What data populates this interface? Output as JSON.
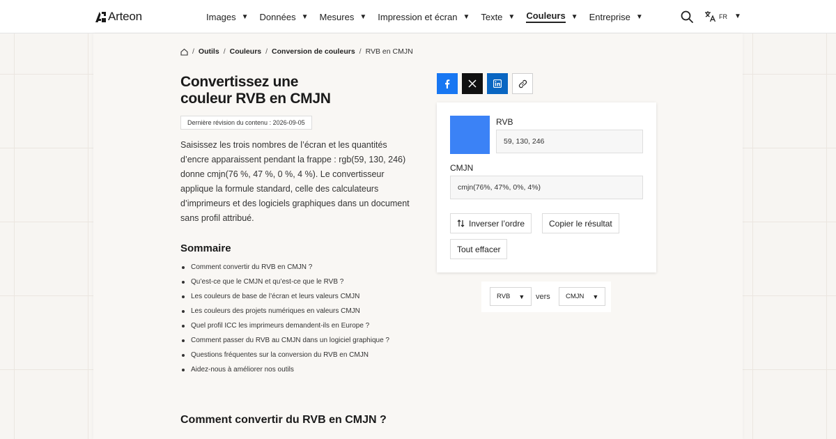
{
  "header": {
    "logo_text": "Arteon",
    "nav": [
      {
        "label": "Images"
      },
      {
        "label": "Données"
      },
      {
        "label": "Mesures"
      },
      {
        "label": "Impression et écran"
      },
      {
        "label": "Texte"
      },
      {
        "label": "Couleurs",
        "active": true
      },
      {
        "label": "Entreprise"
      }
    ],
    "lang": "FR",
    "icons": {
      "search": "search-icon",
      "translate": "translate-icon",
      "caret": "chevron-down-icon"
    }
  },
  "breadcrumb": {
    "home_icon": "home-icon",
    "items": [
      "Outils",
      "Couleurs",
      "Conversion de couleurs"
    ],
    "current": "RVB en CMJN"
  },
  "page": {
    "title_line1": "Convertissez une",
    "title_line2": "couleur RVB en CMJN",
    "revision": "Dernière révision du contenu : 2026-09-05",
    "intro": "Saisissez les trois nombres de l’écran et les quantités d’encre apparaissent pendant la frappe : rgb(59, 130, 246) donne cmjn(76 %, 47 %, 0 %, 4 %). Le convertisseur applique la formule standard, celle des calculateurs d’imprimeurs et des logiciels graphiques dans un document sans profil attribué.",
    "toc_title": "Sommaire",
    "toc": [
      "Comment convertir du RVB en CMJN ?",
      "Qu’est-ce que le CMJN et qu’est-ce que le RVB ?",
      "Les couleurs de base de l’écran et leurs valeurs CMJN",
      "Les couleurs des projets numériques en valeurs CMJN",
      "Quel profil ICC les imprimeurs demandent-ils en Europe ?",
      "Comment passer du RVB au CMJN dans un logiciel graphique ?",
      "Questions fréquentes sur la conversion du RVB en CMJN",
      "Aidez-nous à améliorer nos outils"
    ],
    "section_title": "Comment convertir du RVB en CMJN ?"
  },
  "share": {
    "icons": [
      "facebook-icon",
      "x-icon",
      "linkedin-icon",
      "link-icon"
    ],
    "colors": {
      "facebook": "#1877f2",
      "x": "#111111",
      "linkedin": "#0a66c2"
    }
  },
  "converter": {
    "swatch_color": "#3b82f6",
    "rvb_label": "RVB",
    "rvb_value": "59, 130, 246",
    "cmjn_label": "CMJN",
    "cmjn_value": "cmjn(76%, 47%, 0%, 4%)",
    "swap_label": "Inverser l’ordre",
    "swap_icon": "swap-vertical-icon",
    "copy_label": "Copier le résultat",
    "clear_label": "Tout effacer"
  },
  "format": {
    "from": "RVB",
    "to_word": "vers",
    "to": "CMJN"
  }
}
